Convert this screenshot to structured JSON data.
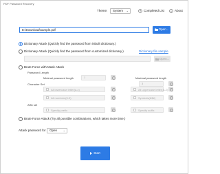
{
  "app": {
    "title": "PDF Password Recovery"
  },
  "header": {
    "theme_label": "Theme:",
    "theme_value": "System",
    "completed_list": "Completed List",
    "about": "About"
  },
  "file": {
    "path": "E:\\Download\\sample.pdf",
    "open_button": "Open..."
  },
  "attacks": {
    "dictionary_inbuilt": "Dictionary Attack (Quickly find the password from inbuilt dictionary.)",
    "dictionary_custom": "Dictionary Attack (Quickly find the password from customized dictionary.)",
    "dictionary_file_sample": "Dictionary file sample",
    "dictionary_open_button": "Open...",
    "brute_force_mask": "Brute Force with Mask Attack",
    "brute_force": "Brute Force Attack (Try all possible combinations, which takes more time.)"
  },
  "mask": {
    "password_length_label": "Password Length",
    "min_length_label": "Minimal password length",
    "min_length_value": "1",
    "max_length_label": "Maximal password length",
    "max_length_value": "3",
    "character_set_label": "Character Set",
    "charset": {
      "lowercase": "All lowercase letter(a-z)",
      "uppercase": "All uppercase letter(A-Z)",
      "numbers": "All numbers(0-9)",
      "symbols": "Symbols(&$#)"
    },
    "affix_label": "Affix set",
    "prefix_placeholder": "Specify prefix",
    "suffix_placeholder": "Specify suffix"
  },
  "footer": {
    "attack_for_label": "Attack password for",
    "attack_for_value": "Open",
    "start_button": "Start"
  },
  "state": {
    "selected_attack": "dictionary_inbuilt"
  },
  "colors": {
    "accent": "#2d7be5"
  }
}
